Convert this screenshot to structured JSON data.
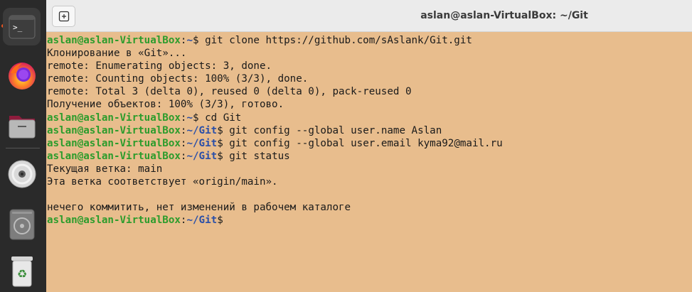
{
  "window": {
    "title": "aslan@aslan-VirtualBox: ~/Git"
  },
  "dock": {
    "items": [
      {
        "name": "terminal-icon",
        "active": true
      },
      {
        "name": "firefox-icon",
        "active": false
      },
      {
        "name": "files-icon",
        "active": false
      },
      {
        "name": "disc-icon",
        "active": false
      },
      {
        "name": "disc-drive-icon",
        "active": false
      },
      {
        "name": "trash-icon",
        "active": false
      }
    ]
  },
  "terminal": {
    "prompt": {
      "user_host": "aslan@aslan-VirtualBox",
      "home_path": "~",
      "git_path": "~/Git",
      "symbol": "$"
    },
    "lines": [
      {
        "type": "prompt",
        "path": "~",
        "cmd": " git clone https://github.com/sAslank/Git.git"
      },
      {
        "type": "output",
        "text": "Клонирование в «Git»..."
      },
      {
        "type": "output",
        "text": "remote: Enumerating objects: 3, done."
      },
      {
        "type": "output",
        "text": "remote: Counting objects: 100% (3/3), done."
      },
      {
        "type": "output",
        "text": "remote: Total 3 (delta 0), reused 0 (delta 0), pack-reused 0"
      },
      {
        "type": "output",
        "text": "Получение объектов: 100% (3/3), готово."
      },
      {
        "type": "prompt",
        "path": "~",
        "cmd": " cd Git"
      },
      {
        "type": "prompt",
        "path": "~/Git",
        "cmd": " git config --global user.name Aslan"
      },
      {
        "type": "prompt",
        "path": "~/Git",
        "cmd": " git config --global user.email kyma92@mail.ru"
      },
      {
        "type": "prompt",
        "path": "~/Git",
        "cmd": " git status"
      },
      {
        "type": "output",
        "text": "Текущая ветка: main"
      },
      {
        "type": "output",
        "text": "Эта ветка соответствует «origin/main»."
      },
      {
        "type": "output",
        "text": ""
      },
      {
        "type": "output",
        "text": "нечего коммитить, нет изменений в рабочем каталоге"
      },
      {
        "type": "prompt",
        "path": "~/Git",
        "cmd": ""
      }
    ]
  },
  "colors": {
    "background": "#e8bd8d",
    "prompt_user": "#2c9c2c",
    "prompt_path": "#2a4fa8",
    "dock": "#2a2a2a",
    "active_indicator": "#e95420"
  }
}
